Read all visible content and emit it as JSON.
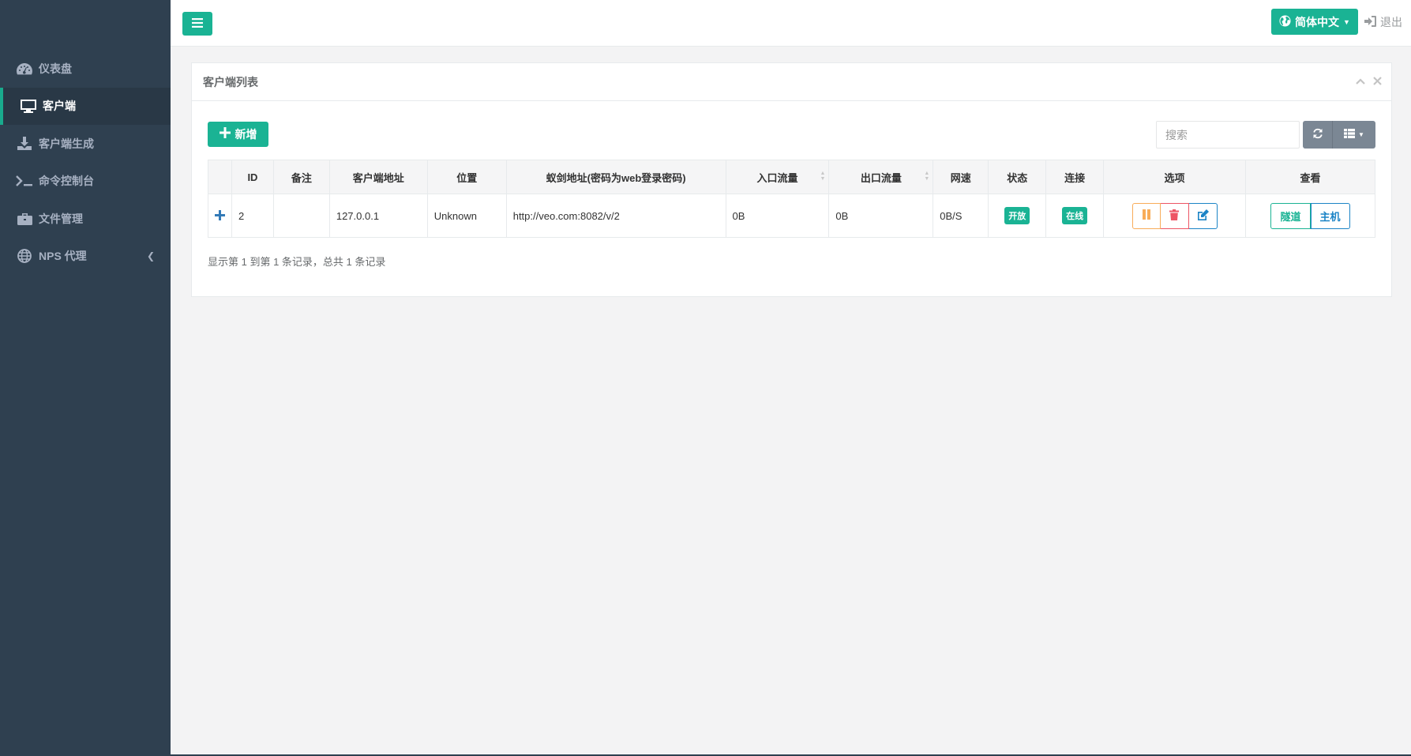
{
  "sidebar": {
    "items": [
      {
        "label": "仪表盘",
        "icon": "dashboard-icon"
      },
      {
        "label": "客户端",
        "icon": "monitor-icon"
      },
      {
        "label": "客户端生成",
        "icon": "download-icon"
      },
      {
        "label": "命令控制台",
        "icon": "terminal-icon"
      },
      {
        "label": "文件管理",
        "icon": "briefcase-icon"
      },
      {
        "label": "NPS 代理",
        "icon": "globe-icon"
      }
    ],
    "active_index": 1
  },
  "topbar": {
    "language_label": "简体中文",
    "logout_label": "退出"
  },
  "panel": {
    "title": "客户端列表",
    "add_label": "新增",
    "search_placeholder": "搜索",
    "summary": "显示第 1 到第 1 条记录，总共 1 条记录"
  },
  "table": {
    "headers": [
      "",
      "ID",
      "备注",
      "客户端地址",
      "位置",
      "蚁剑地址(密码为web登录密码)",
      "入口流量",
      "出口流量",
      "网速",
      "状态",
      "连接",
      "选项",
      "查看"
    ],
    "rows": [
      {
        "id": "2",
        "remark": "",
        "client_addr": "127.0.0.1",
        "location": "Unknown",
        "antsword_url": "http://veo.com:8082/v/2",
        "in_flow": "0B",
        "out_flow": "0B",
        "speed": "0B/S",
        "status": "开放",
        "connection": "在线",
        "view_tunnel": "隧道",
        "view_host": "主机"
      }
    ]
  },
  "colors": {
    "sidebar_bg": "#2f4050",
    "accent": "#1ab394",
    "warning": "#f8ac59",
    "danger": "#ed5565",
    "info": "#1c84c6"
  }
}
